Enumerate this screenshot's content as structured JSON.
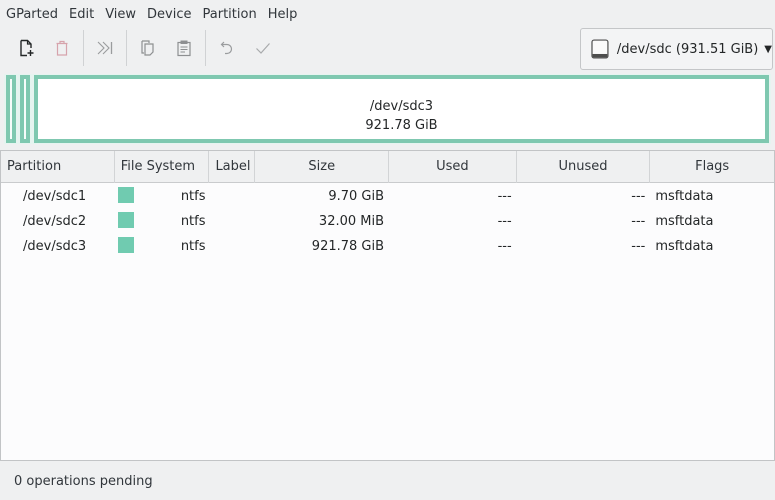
{
  "menubar": {
    "items": [
      "GParted",
      "Edit",
      "View",
      "Device",
      "Partition",
      "Help"
    ]
  },
  "toolbar": {
    "buttons": [
      {
        "name": "new",
        "icon": "new-document-icon",
        "enabled": true
      },
      {
        "name": "delete",
        "icon": "trash-icon",
        "enabled": false
      },
      {
        "name": "resize-move",
        "icon": "resize-move-icon",
        "enabled": false
      },
      {
        "name": "copy",
        "icon": "copy-icon",
        "enabled": false
      },
      {
        "name": "paste",
        "icon": "paste-icon",
        "enabled": false
      },
      {
        "name": "undo",
        "icon": "undo-icon",
        "enabled": false
      },
      {
        "name": "apply",
        "icon": "apply-check-icon",
        "enabled": false
      }
    ]
  },
  "device_selector": {
    "icon": "hard-disk-icon",
    "label": "/dev/sdc  (931.51 GiB)"
  },
  "disk_graph": {
    "selected_partition": {
      "name": "/dev/sdc3",
      "size": "921.78 GiB"
    },
    "partition_color": "#7fc8b0"
  },
  "table": {
    "columns": [
      "Partition",
      "File System",
      "Label",
      "Size",
      "Used",
      "Unused",
      "Flags"
    ],
    "rows": [
      {
        "partition": "/dev/sdc1",
        "filesystem": "ntfs",
        "label": "",
        "size": "9.70 GiB",
        "used": "---",
        "unused": "---",
        "flags": "msftdata"
      },
      {
        "partition": "/dev/sdc2",
        "filesystem": "ntfs",
        "label": "",
        "size": "32.00 MiB",
        "used": "---",
        "unused": "---",
        "flags": "msftdata"
      },
      {
        "partition": "/dev/sdc3",
        "filesystem": "ntfs",
        "label": "",
        "size": "921.78 GiB",
        "used": "---",
        "unused": "---",
        "flags": "msftdata"
      }
    ],
    "fs_color": "#70cbb0"
  },
  "status": {
    "text": "0 operations pending"
  }
}
